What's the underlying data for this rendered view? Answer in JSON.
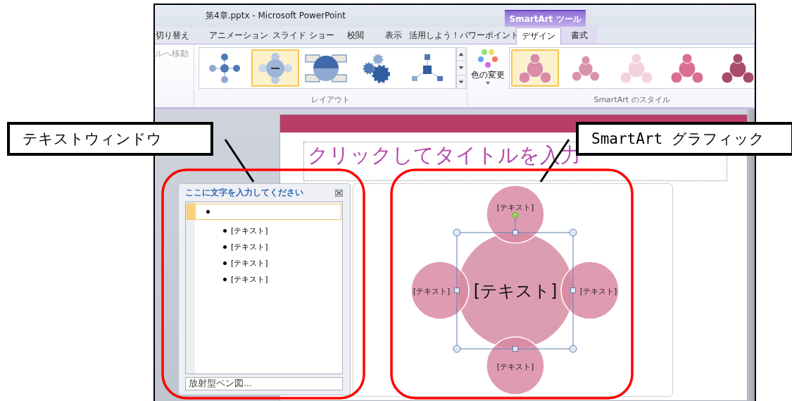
{
  "window": {
    "title": "第4章.pptx  -  Microsoft PowerPoint"
  },
  "contextual_tab_group": {
    "label": "SmartArt ツール"
  },
  "tabs": [
    {
      "label": "切り替え",
      "selected": false,
      "contextual": false
    },
    {
      "label": "アニメーション",
      "selected": false,
      "contextual": false
    },
    {
      "label": "スライド ショー",
      "selected": false,
      "contextual": false
    },
    {
      "label": "校閲",
      "selected": false,
      "contextual": false
    },
    {
      "label": "表示",
      "selected": false,
      "contextual": false
    },
    {
      "label": "活用しよう！パワーポイント",
      "selected": false,
      "contextual": false
    },
    {
      "label": "デザイン",
      "selected": true,
      "contextual": true
    },
    {
      "label": "書式",
      "selected": false,
      "contextual": true
    }
  ],
  "ribbon": {
    "partial_group": {
      "label": "ルへ移動",
      "disabled": true
    },
    "layout_gallery": {
      "label": "レイアウト",
      "items": [
        {
          "kind": "radial",
          "selected": false
        },
        {
          "kind": "venn",
          "selected": true
        },
        {
          "kind": "matrix",
          "selected": false
        },
        {
          "kind": "gears",
          "selected": false
        },
        {
          "kind": "hierarchy",
          "selected": false
        }
      ]
    },
    "color_button": {
      "label": "色の変更"
    },
    "style_gallery": {
      "label": "SmartArt のスタイル",
      "items": [
        {
          "kind": "flat",
          "selected": true
        },
        {
          "kind": "simple",
          "selected": false
        },
        {
          "kind": "light",
          "selected": false
        },
        {
          "kind": "moderate",
          "selected": false
        },
        {
          "kind": "dark",
          "selected": false
        }
      ]
    }
  },
  "slide": {
    "title_placeholder": "クリックしてタイトルを入力"
  },
  "text_pane": {
    "title": "ここに文字を入力してください",
    "items": [
      {
        "selected": true,
        "children": [
          {
            "text": "[テキスト]",
            "selected": false
          },
          {
            "text": "[テキスト]",
            "selected": false
          },
          {
            "text": "[テキスト]",
            "selected": false
          },
          {
            "text": "[テキスト]",
            "selected": false
          }
        ]
      }
    ],
    "footer": "放射型ベン図..."
  },
  "diagram": {
    "center": "[テキスト]",
    "center_selected": true,
    "satellites": [
      "[テキスト]",
      "[テキスト]",
      "[テキスト]",
      "[テキスト]"
    ]
  },
  "annotations": [
    {
      "text": "テキストウィンドウ"
    },
    {
      "text": "SmartArt グラフィック"
    }
  ]
}
